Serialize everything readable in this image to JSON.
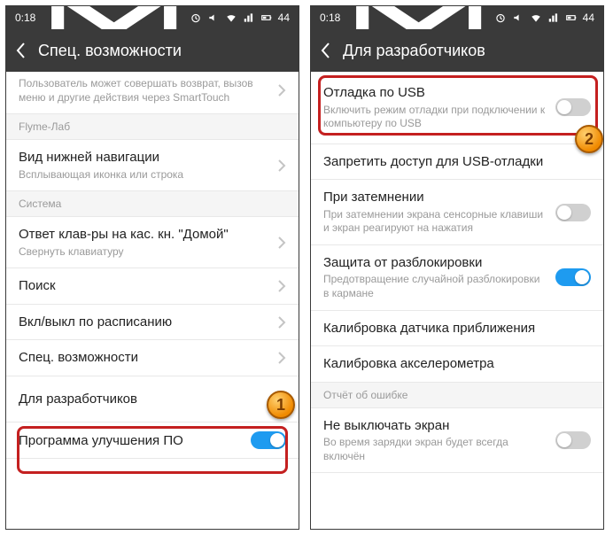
{
  "statusbar": {
    "time": "0:18",
    "battery": "44"
  },
  "left": {
    "title": "Спец. возможности",
    "partial_sub": "Пользователь может совершать возврат, вызов меню и другие действия через SmartTouch",
    "sections": {
      "flyme": "Flyme-Лаб",
      "system": "Система"
    },
    "rows": {
      "nav": {
        "label": "Вид нижней навигации",
        "sub": "Всплывающая иконка или строка"
      },
      "home": {
        "label": "Ответ клав-ры на кас. кн. \"Домой\"",
        "sub": "Свернуть клавиатуру"
      },
      "search": {
        "label": "Поиск"
      },
      "schedule": {
        "label": "Вкл/выкл по расписанию"
      },
      "access": {
        "label": "Спец. возможности"
      },
      "dev": {
        "label": "Для разработчиков"
      },
      "improve": {
        "label": "Программа улучшения ПО"
      }
    }
  },
  "right": {
    "title": "Для разработчиков",
    "rows": {
      "usb": {
        "label": "Отладка по USB",
        "sub": "Включить режим отладки при подключении к компьютеру по USB"
      },
      "deny": {
        "label": "Запретить доступ для USB-отладки"
      },
      "dim": {
        "label": "При затемнении",
        "sub": "При затемнении экрана сенсорные клавиши и экран реагируют на нажатия"
      },
      "unlock": {
        "label": "Защита от разблокировки",
        "sub": "Предотвращение случайной разблокировки в кармане"
      },
      "prox": {
        "label": "Калибровка датчика приближения"
      },
      "accel": {
        "label": "Калибровка акселерометра"
      },
      "bug_h": "Отчёт об ошибке",
      "screen": {
        "label": "Не выключать экран",
        "sub": "Во время зарядки экран будет всегда включён"
      }
    }
  },
  "callouts": {
    "one": "1",
    "two": "2"
  }
}
